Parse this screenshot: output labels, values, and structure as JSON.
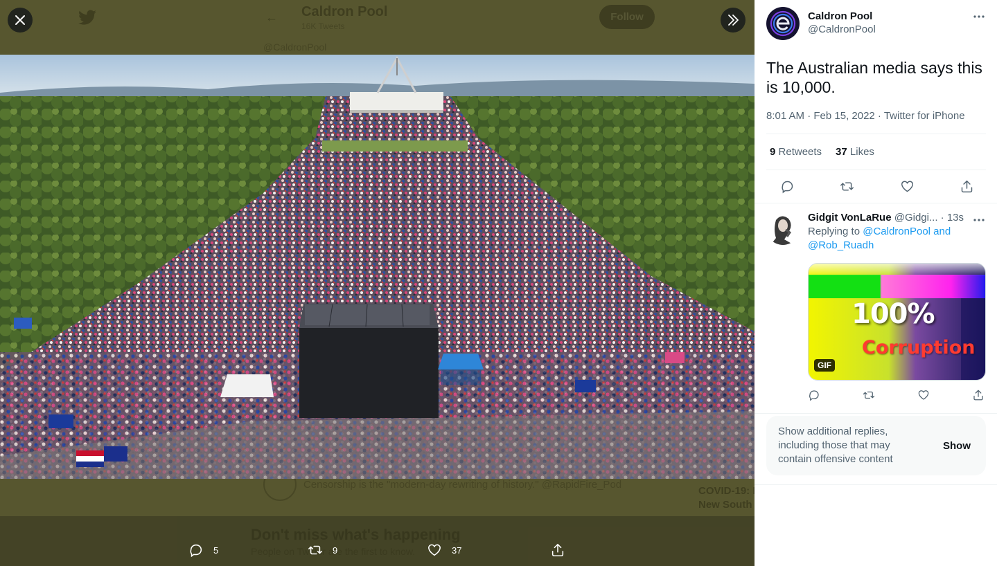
{
  "background_page": {
    "profile_name": "Caldron Pool",
    "tweet_count": "16K Tweets",
    "handle": "@CaldronPool",
    "follow_label": "Follow",
    "bio_snippet": "Censorship is the \"modern-day rewriting of history.\" @RapidFire_Pod",
    "trend_title": "COVID-19: L",
    "trend_sub": "New South",
    "banner_title": "Don't miss what's happening",
    "banner_sub": "People on Twitter are the first to know."
  },
  "viewer": {
    "close_icon": "close-icon",
    "expand_icon": "double-chevron-right-icon",
    "actions": {
      "replies": "5",
      "retweets": "9",
      "likes": "37"
    }
  },
  "tweet": {
    "author_name": "Caldron Pool",
    "author_handle": "@CaldronPool",
    "text": "The Australian media says this is 10,000.",
    "meta": "8:01 AM · Feb 15, 2022 · Twitter for iPhone",
    "retweets_count": "9",
    "retweets_label": "Retweets",
    "likes_count": "37",
    "likes_label": "Likes"
  },
  "reply": {
    "name": "Gidgit VonLaRue",
    "handle": "@Gidgi...",
    "time": "· 13s",
    "replying_prefix": "Replying to",
    "replying_links": "@CaldronPool and @Rob_Ruadh",
    "gif_badge": "GIF",
    "gif_big_text": "100%",
    "gif_word": "Corruption"
  },
  "more_replies": {
    "text": "Show additional replies, including those that may contain offensive content",
    "button": "Show"
  },
  "colors": {
    "accent": "#1d9bf0",
    "viewer_backdrop": "#57562f",
    "secondary_text": "#536471"
  }
}
